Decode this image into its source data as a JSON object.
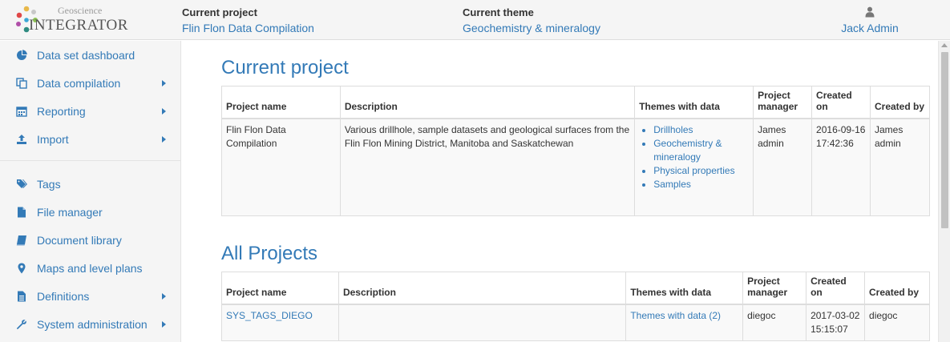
{
  "header": {
    "logo_sub": "Geoscience",
    "logo_main": "INTEGRATOR",
    "current_project_label": "Current project",
    "current_project_value": "Flin Flon Data Compilation",
    "current_theme_label": "Current theme",
    "current_theme_value": "Geochemistry & mineralogy",
    "user_name": "Jack Admin",
    "user_icon": "user-icon"
  },
  "sidebar": {
    "items": [
      {
        "label": "Data set dashboard",
        "icon": "pie-chart-icon",
        "has_submenu": false
      },
      {
        "label": "Data compilation",
        "icon": "copy-icon",
        "has_submenu": true
      },
      {
        "label": "Reporting",
        "icon": "calendar-icon",
        "has_submenu": true
      },
      {
        "label": "Import",
        "icon": "upload-icon",
        "has_submenu": true
      },
      {
        "label": "Tags",
        "icon": "tags-icon",
        "has_submenu": false
      },
      {
        "label": "File manager",
        "icon": "file-icon",
        "has_submenu": false
      },
      {
        "label": "Document library",
        "icon": "book-icon",
        "has_submenu": false
      },
      {
        "label": "Maps and level plans",
        "icon": "map-marker-icon",
        "has_submenu": false
      },
      {
        "label": "Definitions",
        "icon": "file-text-icon",
        "has_submenu": true
      },
      {
        "label": "System administration",
        "icon": "wrench-icon",
        "has_submenu": true
      }
    ]
  },
  "current_project": {
    "heading": "Current project",
    "columns": [
      "Project name",
      "Description",
      "Themes with data",
      "Project manager",
      "Created on",
      "Created by"
    ],
    "row": {
      "name": "Flin Flon Data Compilation",
      "description": "Various drillhole, sample datasets and geological surfaces from the Flin Flon Mining District, Manitoba and Saskatchewan",
      "themes": [
        "Drillholes",
        "Geochemistry & mineralogy",
        "Physical properties",
        "Samples"
      ],
      "manager": "James admin",
      "created_on": "2016-09-16 17:42:36",
      "created_by": "James admin"
    }
  },
  "all_projects": {
    "heading": "All Projects",
    "columns": [
      "Project name",
      "Description",
      "Themes with data",
      "Project manager",
      "Created on",
      "Created by"
    ],
    "rows": [
      {
        "name": "SYS_TAGS_DIEGO",
        "description": "",
        "themes": "Themes with data (2)",
        "manager": "diegoc",
        "created_on": "2017-03-02 15:15:07",
        "created_by": "diegoc"
      }
    ]
  },
  "colors": {
    "link": "#337ab7",
    "logo_dots": [
      "#e8b84a",
      "#c8c8c8",
      "#e04848",
      "#8cc152",
      "#b04fa8",
      "#3aa6d6",
      "#2e8b80"
    ]
  }
}
